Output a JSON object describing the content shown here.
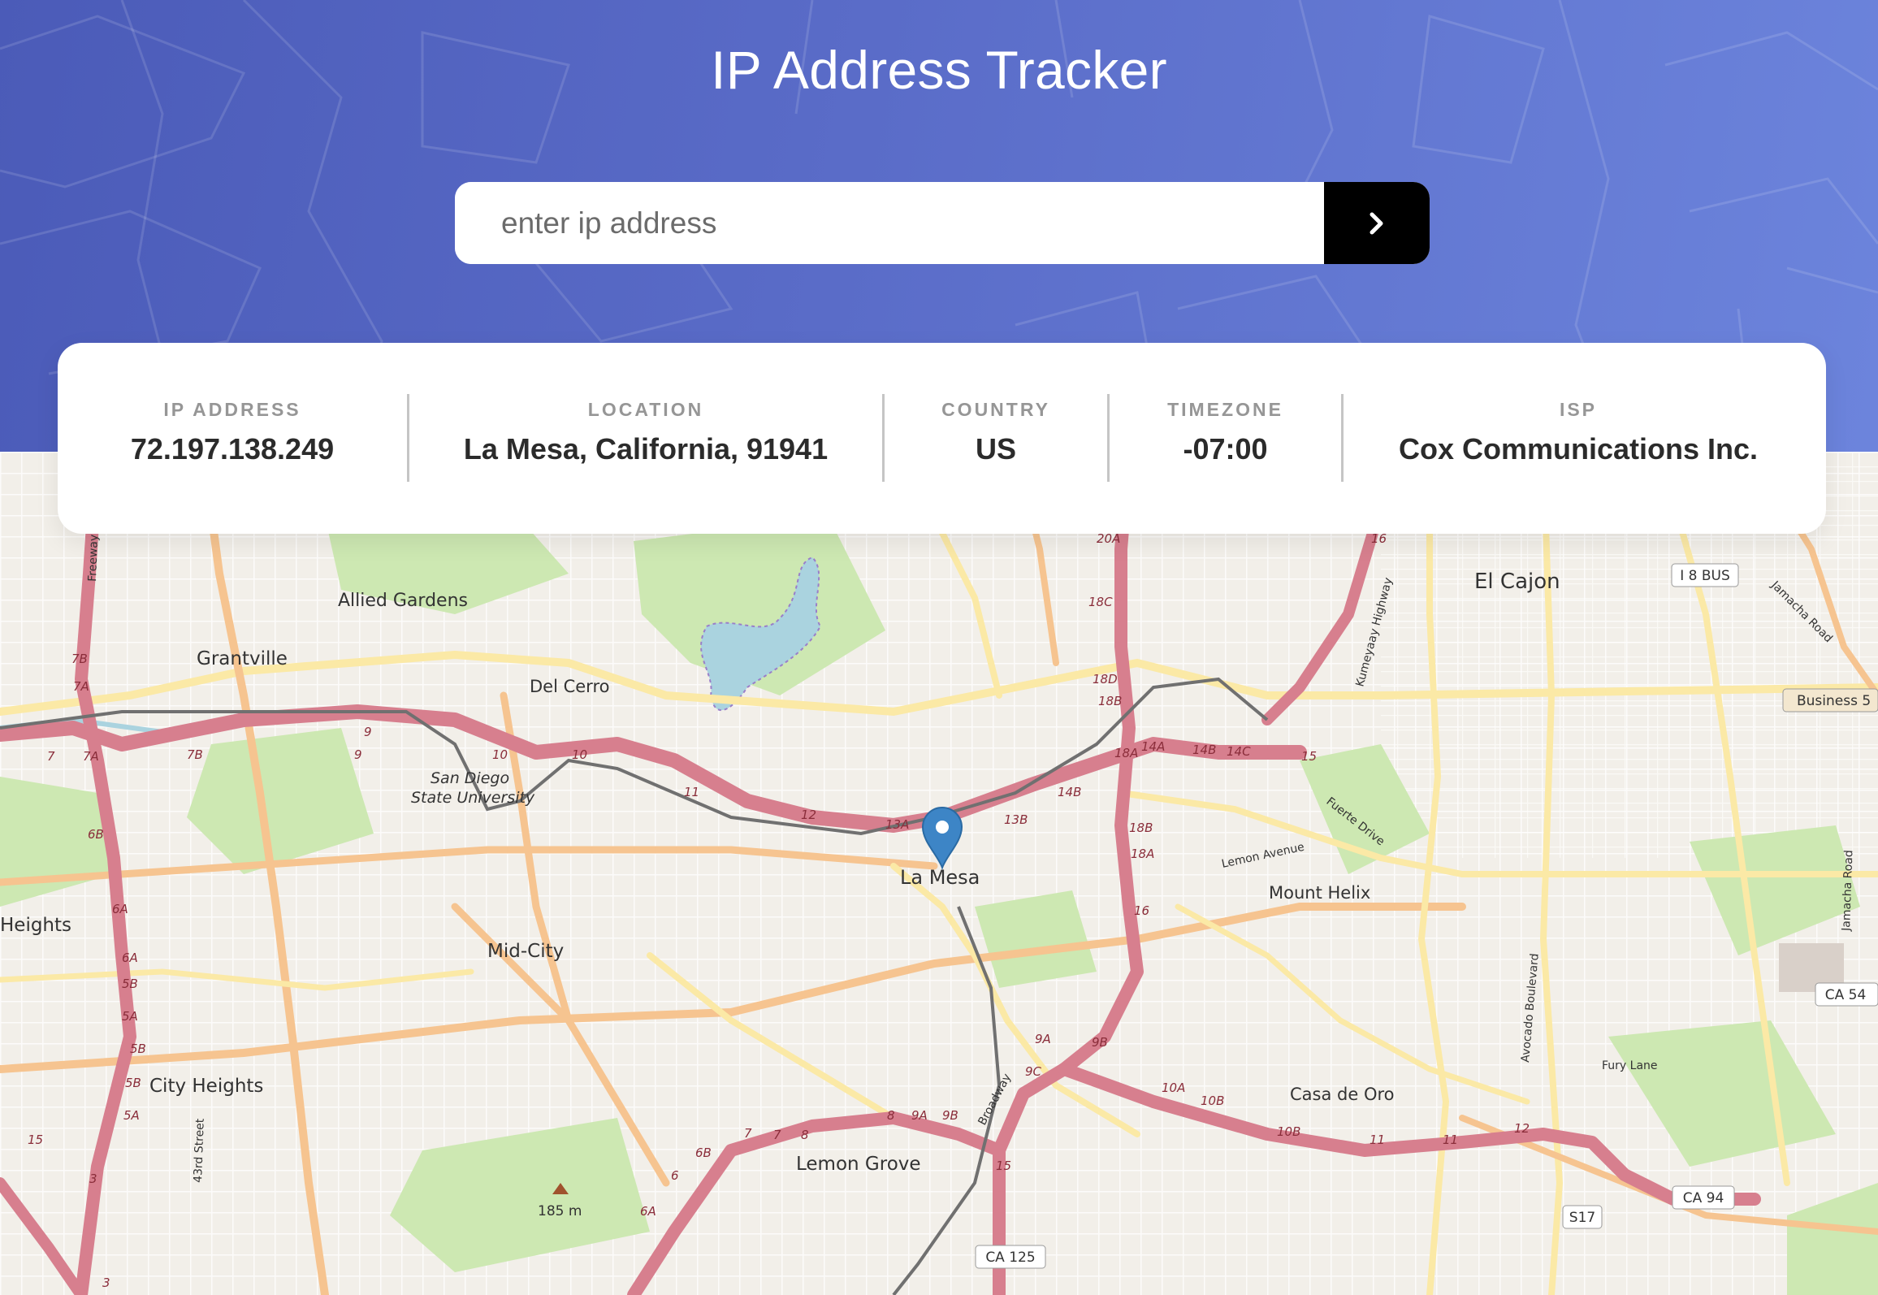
{
  "app": {
    "title": "IP Address Tracker"
  },
  "search": {
    "placeholder": "enter ip address",
    "value": "",
    "button_icon": "chevron-right-icon"
  },
  "info": {
    "ip": {
      "label": "IP ADDRESS",
      "value": "72.197.138.249"
    },
    "location": {
      "label": "LOCATION",
      "value": "La Mesa, California, 91941"
    },
    "country": {
      "label": "COUNTRY",
      "value": "US"
    },
    "timezone": {
      "label": "TIMEZONE",
      "value": "-07:00"
    },
    "isp": {
      "label": "ISP",
      "value": "Cox Communications Inc."
    }
  },
  "map": {
    "marker_icon": "map-pin-icon",
    "places": [
      "El Cajon",
      "Allied Gardens",
      "Grantville",
      "Del Cerro",
      "San Diego",
      "State University",
      "La Mesa",
      "Mount Helix",
      "Heights",
      "Mid-City",
      "City Heights",
      "Casa de Oro",
      "Lemon Grove",
      "185 m"
    ],
    "roads": [
      "Lemon Avenue",
      "Fuerte Drive",
      "Kumeyaay Highway",
      "Jamacha Road",
      "Jamacha Road",
      "Avocado Boulevard",
      "Fury Lane",
      "43rd Street",
      "Broadway",
      "Freeway"
    ],
    "shields": [
      "I 8 BUS",
      "Business 5",
      "CA 54",
      "CA 94",
      "S17",
      "CA 125"
    ],
    "exits": [
      "20A",
      "18C",
      "18D",
      "18B",
      "18A",
      "16",
      "14A",
      "14B",
      "14C",
      "15",
      "14B",
      "13B",
      "13A",
      "12",
      "11",
      "10",
      "10",
      "9",
      "9",
      "7B",
      "7A",
      "7",
      "7A",
      "7B",
      "6B",
      "6A",
      "6A",
      "5B",
      "5A",
      "5B",
      "5B",
      "5A",
      "15",
      "3",
      "3",
      "18B",
      "18A",
      "16",
      "9A",
      "9B",
      "9C",
      "8",
      "9A",
      "9B",
      "15",
      "10A",
      "10B",
      "10B",
      "11",
      "11",
      "12",
      "7",
      "7",
      "8",
      "6B",
      "6",
      "6A"
    ]
  },
  "colors": {
    "header_start": "#4b5bb8",
    "header_end": "#6c84dc",
    "motorway": "#d77f8e",
    "trunk_road": "#f2e9a0",
    "primary_road": "#f6c490",
    "water": "#aad3df",
    "park": "#cde8b2",
    "marker": "#3d85c6"
  }
}
